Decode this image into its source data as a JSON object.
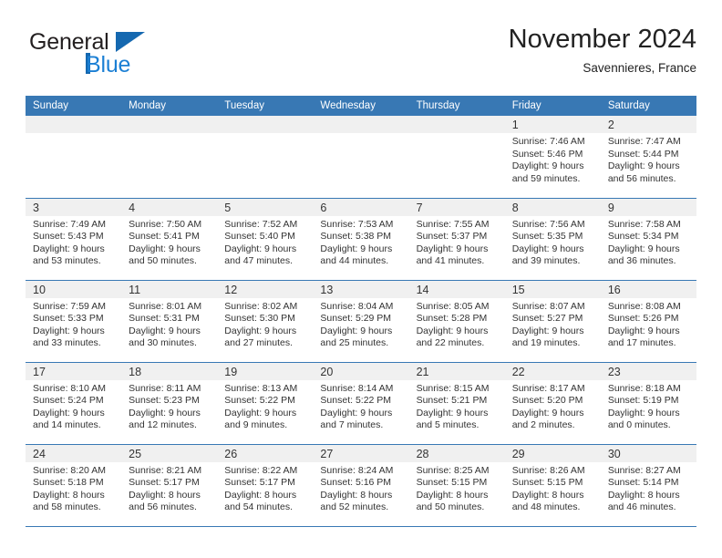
{
  "brand": {
    "name_part1": "General",
    "name_part2": "Blue",
    "triangle_color": "#1568b0",
    "blue_color": "#1b7fd4"
  },
  "header": {
    "title": "November 2024",
    "subtitle": "Savennieres, France"
  },
  "theme": {
    "header_bar": "#3878b4",
    "daynum_band": "#f0f0f0",
    "rule": "#3878b4"
  },
  "weekdays": [
    "Sunday",
    "Monday",
    "Tuesday",
    "Wednesday",
    "Thursday",
    "Friday",
    "Saturday"
  ],
  "weeks": [
    [
      {
        "empty": true
      },
      {
        "empty": true
      },
      {
        "empty": true
      },
      {
        "empty": true
      },
      {
        "empty": true
      },
      {
        "day": "1",
        "sunrise": "Sunrise: 7:46 AM",
        "sunset": "Sunset: 5:46 PM",
        "daylight1": "Daylight: 9 hours",
        "daylight2": "and 59 minutes."
      },
      {
        "day": "2",
        "sunrise": "Sunrise: 7:47 AM",
        "sunset": "Sunset: 5:44 PM",
        "daylight1": "Daylight: 9 hours",
        "daylight2": "and 56 minutes."
      }
    ],
    [
      {
        "day": "3",
        "sunrise": "Sunrise: 7:49 AM",
        "sunset": "Sunset: 5:43 PM",
        "daylight1": "Daylight: 9 hours",
        "daylight2": "and 53 minutes."
      },
      {
        "day": "4",
        "sunrise": "Sunrise: 7:50 AM",
        "sunset": "Sunset: 5:41 PM",
        "daylight1": "Daylight: 9 hours",
        "daylight2": "and 50 minutes."
      },
      {
        "day": "5",
        "sunrise": "Sunrise: 7:52 AM",
        "sunset": "Sunset: 5:40 PM",
        "daylight1": "Daylight: 9 hours",
        "daylight2": "and 47 minutes."
      },
      {
        "day": "6",
        "sunrise": "Sunrise: 7:53 AM",
        "sunset": "Sunset: 5:38 PM",
        "daylight1": "Daylight: 9 hours",
        "daylight2": "and 44 minutes."
      },
      {
        "day": "7",
        "sunrise": "Sunrise: 7:55 AM",
        "sunset": "Sunset: 5:37 PM",
        "daylight1": "Daylight: 9 hours",
        "daylight2": "and 41 minutes."
      },
      {
        "day": "8",
        "sunrise": "Sunrise: 7:56 AM",
        "sunset": "Sunset: 5:35 PM",
        "daylight1": "Daylight: 9 hours",
        "daylight2": "and 39 minutes."
      },
      {
        "day": "9",
        "sunrise": "Sunrise: 7:58 AM",
        "sunset": "Sunset: 5:34 PM",
        "daylight1": "Daylight: 9 hours",
        "daylight2": "and 36 minutes."
      }
    ],
    [
      {
        "day": "10",
        "sunrise": "Sunrise: 7:59 AM",
        "sunset": "Sunset: 5:33 PM",
        "daylight1": "Daylight: 9 hours",
        "daylight2": "and 33 minutes."
      },
      {
        "day": "11",
        "sunrise": "Sunrise: 8:01 AM",
        "sunset": "Sunset: 5:31 PM",
        "daylight1": "Daylight: 9 hours",
        "daylight2": "and 30 minutes."
      },
      {
        "day": "12",
        "sunrise": "Sunrise: 8:02 AM",
        "sunset": "Sunset: 5:30 PM",
        "daylight1": "Daylight: 9 hours",
        "daylight2": "and 27 minutes."
      },
      {
        "day": "13",
        "sunrise": "Sunrise: 8:04 AM",
        "sunset": "Sunset: 5:29 PM",
        "daylight1": "Daylight: 9 hours",
        "daylight2": "and 25 minutes."
      },
      {
        "day": "14",
        "sunrise": "Sunrise: 8:05 AM",
        "sunset": "Sunset: 5:28 PM",
        "daylight1": "Daylight: 9 hours",
        "daylight2": "and 22 minutes."
      },
      {
        "day": "15",
        "sunrise": "Sunrise: 8:07 AM",
        "sunset": "Sunset: 5:27 PM",
        "daylight1": "Daylight: 9 hours",
        "daylight2": "and 19 minutes."
      },
      {
        "day": "16",
        "sunrise": "Sunrise: 8:08 AM",
        "sunset": "Sunset: 5:26 PM",
        "daylight1": "Daylight: 9 hours",
        "daylight2": "and 17 minutes."
      }
    ],
    [
      {
        "day": "17",
        "sunrise": "Sunrise: 8:10 AM",
        "sunset": "Sunset: 5:24 PM",
        "daylight1": "Daylight: 9 hours",
        "daylight2": "and 14 minutes."
      },
      {
        "day": "18",
        "sunrise": "Sunrise: 8:11 AM",
        "sunset": "Sunset: 5:23 PM",
        "daylight1": "Daylight: 9 hours",
        "daylight2": "and 12 minutes."
      },
      {
        "day": "19",
        "sunrise": "Sunrise: 8:13 AM",
        "sunset": "Sunset: 5:22 PM",
        "daylight1": "Daylight: 9 hours",
        "daylight2": "and 9 minutes."
      },
      {
        "day": "20",
        "sunrise": "Sunrise: 8:14 AM",
        "sunset": "Sunset: 5:22 PM",
        "daylight1": "Daylight: 9 hours",
        "daylight2": "and 7 minutes."
      },
      {
        "day": "21",
        "sunrise": "Sunrise: 8:15 AM",
        "sunset": "Sunset: 5:21 PM",
        "daylight1": "Daylight: 9 hours",
        "daylight2": "and 5 minutes."
      },
      {
        "day": "22",
        "sunrise": "Sunrise: 8:17 AM",
        "sunset": "Sunset: 5:20 PM",
        "daylight1": "Daylight: 9 hours",
        "daylight2": "and 2 minutes."
      },
      {
        "day": "23",
        "sunrise": "Sunrise: 8:18 AM",
        "sunset": "Sunset: 5:19 PM",
        "daylight1": "Daylight: 9 hours",
        "daylight2": "and 0 minutes."
      }
    ],
    [
      {
        "day": "24",
        "sunrise": "Sunrise: 8:20 AM",
        "sunset": "Sunset: 5:18 PM",
        "daylight1": "Daylight: 8 hours",
        "daylight2": "and 58 minutes."
      },
      {
        "day": "25",
        "sunrise": "Sunrise: 8:21 AM",
        "sunset": "Sunset: 5:17 PM",
        "daylight1": "Daylight: 8 hours",
        "daylight2": "and 56 minutes."
      },
      {
        "day": "26",
        "sunrise": "Sunrise: 8:22 AM",
        "sunset": "Sunset: 5:17 PM",
        "daylight1": "Daylight: 8 hours",
        "daylight2": "and 54 minutes."
      },
      {
        "day": "27",
        "sunrise": "Sunrise: 8:24 AM",
        "sunset": "Sunset: 5:16 PM",
        "daylight1": "Daylight: 8 hours",
        "daylight2": "and 52 minutes."
      },
      {
        "day": "28",
        "sunrise": "Sunrise: 8:25 AM",
        "sunset": "Sunset: 5:15 PM",
        "daylight1": "Daylight: 8 hours",
        "daylight2": "and 50 minutes."
      },
      {
        "day": "29",
        "sunrise": "Sunrise: 8:26 AM",
        "sunset": "Sunset: 5:15 PM",
        "daylight1": "Daylight: 8 hours",
        "daylight2": "and 48 minutes."
      },
      {
        "day": "30",
        "sunrise": "Sunrise: 8:27 AM",
        "sunset": "Sunset: 5:14 PM",
        "daylight1": "Daylight: 8 hours",
        "daylight2": "and 46 minutes."
      }
    ]
  ]
}
